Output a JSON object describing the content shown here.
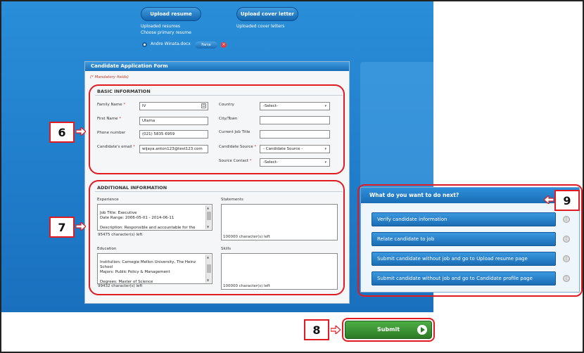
{
  "upload": {
    "upload_resume_label": "Upload resume",
    "upload_cover_letter_label": "Upload cover letter",
    "uploaded_resumes": "Uploaded resumes",
    "choose_primary": "Choose primary resume",
    "uploaded_cover_letters": "Uploaded cover letters",
    "resume_file": "Andre Winata.docx",
    "parse_label": "Parse",
    "delete_glyph": "×"
  },
  "form": {
    "title": "Candidate Application Form",
    "mandatory_note": "(* Mandatory fields)",
    "basic": {
      "title": "BASIC INFORMATION",
      "family_name_label": "Family Name",
      "family_name_value": "IV",
      "first_name_label": "First Name",
      "first_name_value": "Utama",
      "phone_label": "Phone number",
      "phone_value": "(021) 5835 6959",
      "email_label": "Candidate's email",
      "email_value": "wijaya.anton123@test123.com",
      "country_label": "Country",
      "country_value": "-Select-",
      "city_label": "City/Town",
      "job_title_label": "Current Job Title",
      "source_label": "Candidate Source",
      "source_value": "- Candidate Source -",
      "source_contact_label": "Source Contact",
      "source_contact_value": "-Select-",
      "req_mark": "*"
    },
    "additional": {
      "title": "ADDITIONAL INFORMATION",
      "experience_label": "Experience",
      "experience_text": " Job Title: Executive\nDate Range: 2006-05-01 - 2014-06-11\n\nDescription: Responsible and accountable for the coordinated management of multiple related",
      "experience_count": "95475 character(s) left",
      "statements_label": "Statements",
      "statements_count": "100000 character(s) left",
      "education_label": "Education",
      "education_text": " Institution: Carnegie Mellon University, The Heinz School\nMajors: Public Policy & Management\n\nDegrees: Master of Science",
      "education_count": "99432 character(s) left",
      "skills_label": "Skills",
      "skills_count": "100000 character(s) left"
    }
  },
  "todo": {
    "title": "What do you want to do next?",
    "options": [
      "Verify candidate information",
      "Relate candidate to job",
      "Submit candidate without job and go to Upload resume page",
      "Submit candidate without job and go to Candidate profile page"
    ]
  },
  "submit_label": "Submit",
  "callouts": {
    "six": "6",
    "seven": "7",
    "eight": "8",
    "nine": "9"
  },
  "colors": {
    "accent_blue": "#1f7cc9",
    "highlight_red": "#e11b22",
    "submit_green": "#2b7a25"
  }
}
